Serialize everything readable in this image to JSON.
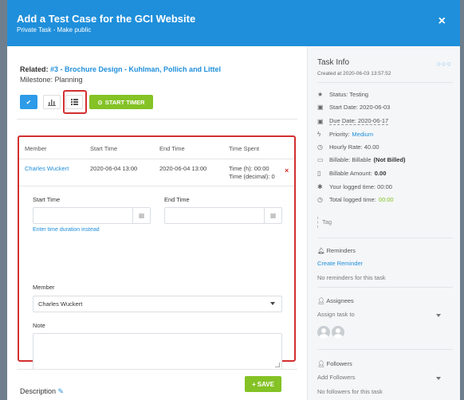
{
  "modal": {
    "title": "Add a Test Case for the GCI Website",
    "subtitle": "Private Task - Make public",
    "close_label": "×"
  },
  "left": {
    "related_label": "Related:",
    "related_link": "#3 - Brochure Design - Kuhlman, Pollich and Littel",
    "milestone": "Milestone: Planning",
    "toolbar": {
      "check_icon": "✔",
      "chart_icon": "📊",
      "list_icon": "≡",
      "start_timer": "START TIMER"
    },
    "timesheet": {
      "headers": [
        "Member",
        "Start Time",
        "End Time",
        "Time Spent"
      ],
      "row": {
        "member": "Charles Wuckert",
        "start": "2020-06-04 13:00",
        "end": "2020-06-04 13:00",
        "spent_hm": "Time (h): 00:00",
        "spent_decimal": "Time (decimal): 0",
        "delete": "×"
      },
      "start_time_label": "Start Time",
      "end_time_label": "End Time",
      "start_time_value": "",
      "end_time_value": "",
      "duration_link": "Enter time duration instead",
      "member_label": "Member",
      "member_value": "Charles Wuckert",
      "note_label": "Note",
      "note_value": "",
      "save_label": "SAVE"
    },
    "description_label": "Description"
  },
  "right": {
    "title": "Task Info",
    "created": "Created at 2020-06-03 13:57:52",
    "dots": "○○○",
    "status": "Status: Testing",
    "start_date": "Start Date: 2020-06-03",
    "due_date": "Due Date: 2020-06-17",
    "priority_label": "Priority:",
    "priority_value": "Medium",
    "hourly_rate": "Hourly Rate: 40.00",
    "billable_label": "Billable: Billable",
    "billable_value": "(Not Billed)",
    "billable_amount_label": "Billable Amount:",
    "billable_amount_value": "0.00",
    "your_logged": "Your logged time: 00:00",
    "total_logged_label": "Total logged time:",
    "total_logged_value": "00:00",
    "tag_placeholder": "Tag",
    "reminders_title": "Reminders",
    "create_reminder": "Create Reminder",
    "no_reminders": "No reminders for this task",
    "assignees_title": "Assignees",
    "assign_placeholder": "Assign task to",
    "followers_title": "Followers",
    "followers_placeholder": "Add Followers",
    "no_followers": "No followers for this task"
  }
}
